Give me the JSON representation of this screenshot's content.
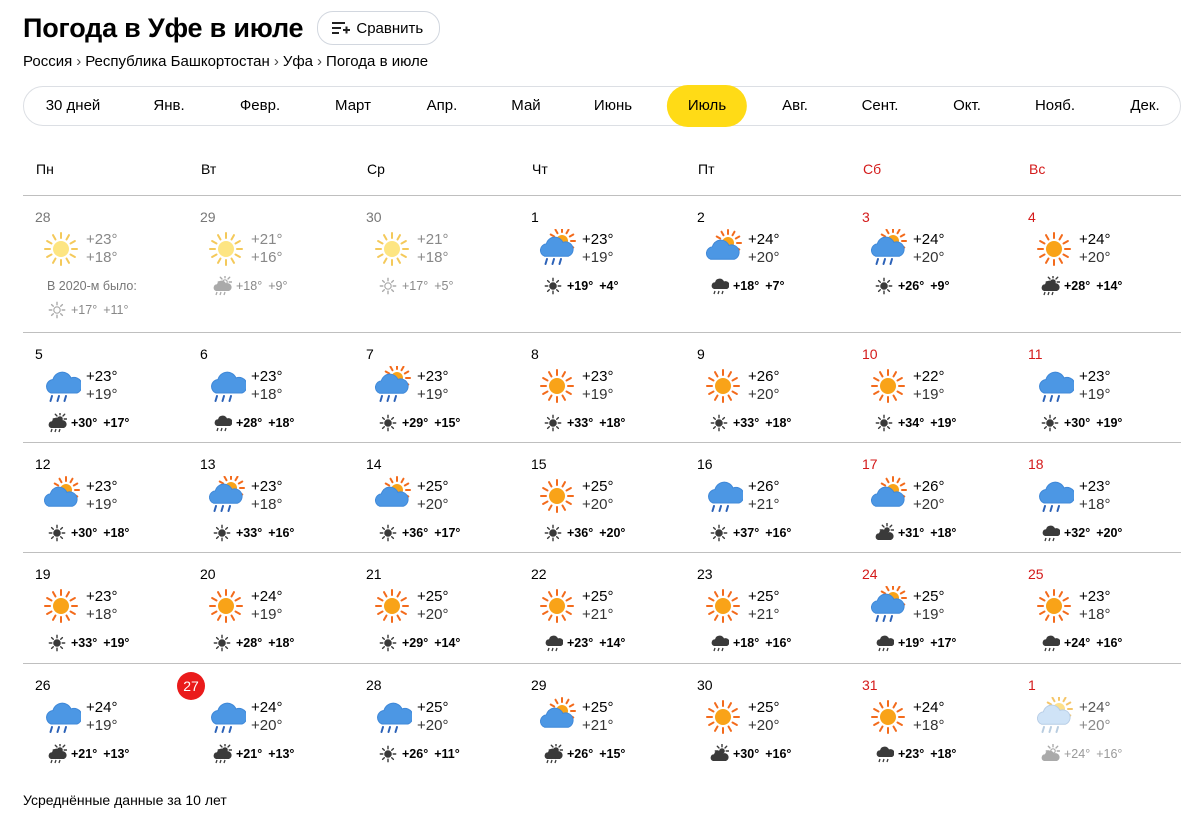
{
  "page": {
    "title": "Погода в Уфе в июле",
    "compare_label": "Сравнить",
    "breadcrumb": [
      "Россия",
      "Республика Башкортостан",
      "Уфа",
      "Погода в июле"
    ],
    "breadcrumb_separator": "›",
    "footer_note": "Усреднённые данные за 10 лет",
    "note_2020": "В 2020-м было:"
  },
  "month_tabs": [
    {
      "label": "30 дней",
      "active": false
    },
    {
      "label": "Янв.",
      "active": false
    },
    {
      "label": "Февр.",
      "active": false
    },
    {
      "label": "Март",
      "active": false
    },
    {
      "label": "Апр.",
      "active": false
    },
    {
      "label": "Май",
      "active": false
    },
    {
      "label": "Июнь",
      "active": false
    },
    {
      "label": "Июль",
      "active": true
    },
    {
      "label": "Авг.",
      "active": false
    },
    {
      "label": "Сент.",
      "active": false
    },
    {
      "label": "Окт.",
      "active": false
    },
    {
      "label": "Нояб.",
      "active": false
    },
    {
      "label": "Дек.",
      "active": false
    }
  ],
  "weekdays": [
    {
      "label": "Пн",
      "weekend": false
    },
    {
      "label": "Вт",
      "weekend": false
    },
    {
      "label": "Ср",
      "weekend": false
    },
    {
      "label": "Чт",
      "weekend": false
    },
    {
      "label": "Пт",
      "weekend": false
    },
    {
      "label": "Сб",
      "weekend": true
    },
    {
      "label": "Вс",
      "weekend": true
    }
  ],
  "colors": {
    "accent": "#ffdb16",
    "weekend": "#d41a1a",
    "today": "#ea1b1b"
  },
  "weeks": [
    [
      {
        "day": "28",
        "icon": "sun",
        "day_temp": "+23°",
        "night_temp": "+18°",
        "hist_icon": "sun",
        "hist_high": "",
        "hist_low": "",
        "other_month": true,
        "note": true,
        "note_icon": "sun-small",
        "note_high": "+17°",
        "note_low": "+11°"
      },
      {
        "day": "29",
        "icon": "sun",
        "day_temp": "+21°",
        "night_temp": "+16°",
        "hist_icon": "sun-cloud-rain",
        "hist_high": "+18°",
        "hist_low": "+9°",
        "other_month": true
      },
      {
        "day": "30",
        "icon": "sun",
        "day_temp": "+21°",
        "night_temp": "+18°",
        "hist_icon": "sun-small",
        "hist_high": "+17°",
        "hist_low": "+5°",
        "other_month": true
      },
      {
        "day": "1",
        "icon": "partly-rain",
        "day_temp": "+23°",
        "night_temp": "+19°",
        "hist_icon": "sun-small",
        "hist_high": "+19°",
        "hist_low": "+4°"
      },
      {
        "day": "2",
        "icon": "partly-cloudy",
        "day_temp": "+24°",
        "night_temp": "+20°",
        "hist_icon": "cloud-rain",
        "hist_high": "+18°",
        "hist_low": "+7°"
      },
      {
        "day": "3",
        "icon": "partly-rain",
        "day_temp": "+24°",
        "night_temp": "+20°",
        "hist_icon": "sun-small",
        "hist_high": "+26°",
        "hist_low": "+9°",
        "weekend": true
      },
      {
        "day": "4",
        "icon": "sun",
        "day_temp": "+24°",
        "night_temp": "+20°",
        "hist_icon": "sun-cloud-rain",
        "hist_high": "+28°",
        "hist_low": "+14°",
        "weekend": true
      }
    ],
    [
      {
        "day": "5",
        "icon": "cloud-rain",
        "day_temp": "+23°",
        "night_temp": "+19°",
        "hist_icon": "sun-cloud-rain",
        "hist_high": "+30°",
        "hist_low": "+17°"
      },
      {
        "day": "6",
        "icon": "cloud-rain",
        "day_temp": "+23°",
        "night_temp": "+18°",
        "hist_icon": "cloud-rain",
        "hist_high": "+28°",
        "hist_low": "+18°"
      },
      {
        "day": "7",
        "icon": "partly-rain",
        "day_temp": "+23°",
        "night_temp": "+19°",
        "hist_icon": "sun-small",
        "hist_high": "+29°",
        "hist_low": "+15°"
      },
      {
        "day": "8",
        "icon": "sun",
        "day_temp": "+23°",
        "night_temp": "+19°",
        "hist_icon": "sun-small",
        "hist_high": "+33°",
        "hist_low": "+18°"
      },
      {
        "day": "9",
        "icon": "sun",
        "day_temp": "+26°",
        "night_temp": "+20°",
        "hist_icon": "sun-small",
        "hist_high": "+33°",
        "hist_low": "+18°"
      },
      {
        "day": "10",
        "icon": "sun",
        "day_temp": "+22°",
        "night_temp": "+19°",
        "hist_icon": "sun-small",
        "hist_high": "+34°",
        "hist_low": "+19°",
        "weekend": true
      },
      {
        "day": "11",
        "icon": "cloud-rain",
        "day_temp": "+23°",
        "night_temp": "+19°",
        "hist_icon": "sun-small",
        "hist_high": "+30°",
        "hist_low": "+19°",
        "weekend": true
      }
    ],
    [
      {
        "day": "12",
        "icon": "partly-cloudy",
        "day_temp": "+23°",
        "night_temp": "+19°",
        "hist_icon": "sun-small",
        "hist_high": "+30°",
        "hist_low": "+18°"
      },
      {
        "day": "13",
        "icon": "partly-rain",
        "day_temp": "+23°",
        "night_temp": "+18°",
        "hist_icon": "sun-small",
        "hist_high": "+33°",
        "hist_low": "+16°"
      },
      {
        "day": "14",
        "icon": "partly-cloudy",
        "day_temp": "+25°",
        "night_temp": "+20°",
        "hist_icon": "sun-small",
        "hist_high": "+36°",
        "hist_low": "+17°"
      },
      {
        "day": "15",
        "icon": "sun",
        "day_temp": "+25°",
        "night_temp": "+20°",
        "hist_icon": "sun-small",
        "hist_high": "+36°",
        "hist_low": "+20°"
      },
      {
        "day": "16",
        "icon": "cloud-rain",
        "day_temp": "+26°",
        "night_temp": "+21°",
        "hist_icon": "sun-small",
        "hist_high": "+37°",
        "hist_low": "+16°"
      },
      {
        "day": "17",
        "icon": "partly-cloudy",
        "day_temp": "+26°",
        "night_temp": "+20°",
        "hist_icon": "cloud-sun",
        "hist_high": "+31°",
        "hist_low": "+18°",
        "weekend": true
      },
      {
        "day": "18",
        "icon": "cloud-rain",
        "day_temp": "+23°",
        "night_temp": "+18°",
        "hist_icon": "cloud-rain",
        "hist_high": "+32°",
        "hist_low": "+20°",
        "weekend": true
      }
    ],
    [
      {
        "day": "19",
        "icon": "sun",
        "day_temp": "+23°",
        "night_temp": "+18°",
        "hist_icon": "sun-small",
        "hist_high": "+33°",
        "hist_low": "+19°"
      },
      {
        "day": "20",
        "icon": "sun",
        "day_temp": "+24°",
        "night_temp": "+19°",
        "hist_icon": "sun-small",
        "hist_high": "+28°",
        "hist_low": "+18°"
      },
      {
        "day": "21",
        "icon": "sun",
        "day_temp": "+25°",
        "night_temp": "+20°",
        "hist_icon": "sun-small",
        "hist_high": "+29°",
        "hist_low": "+14°"
      },
      {
        "day": "22",
        "icon": "sun",
        "day_temp": "+25°",
        "night_temp": "+21°",
        "hist_icon": "cloud-rain",
        "hist_high": "+23°",
        "hist_low": "+14°"
      },
      {
        "day": "23",
        "icon": "sun",
        "day_temp": "+25°",
        "night_temp": "+21°",
        "hist_icon": "cloud-rain",
        "hist_high": "+18°",
        "hist_low": "+16°"
      },
      {
        "day": "24",
        "icon": "partly-rain",
        "day_temp": "+25°",
        "night_temp": "+19°",
        "hist_icon": "cloud-rain",
        "hist_high": "+19°",
        "hist_low": "+17°",
        "weekend": true
      },
      {
        "day": "25",
        "icon": "sun",
        "day_temp": "+23°",
        "night_temp": "+18°",
        "hist_icon": "cloud-rain",
        "hist_high": "+24°",
        "hist_low": "+16°",
        "weekend": true
      }
    ],
    [
      {
        "day": "26",
        "icon": "cloud-rain",
        "day_temp": "+24°",
        "night_temp": "+19°",
        "hist_icon": "sun-cloud-rain",
        "hist_high": "+21°",
        "hist_low": "+13°"
      },
      {
        "day": "27",
        "icon": "cloud-rain",
        "day_temp": "+24°",
        "night_temp": "+20°",
        "hist_icon": "sun-cloud-rain",
        "hist_high": "+21°",
        "hist_low": "+13°",
        "today": true
      },
      {
        "day": "28",
        "icon": "cloud-rain",
        "day_temp": "+25°",
        "night_temp": "+20°",
        "hist_icon": "sun-small",
        "hist_high": "+26°",
        "hist_low": "+11°"
      },
      {
        "day": "29",
        "icon": "partly-cloudy",
        "day_temp": "+25°",
        "night_temp": "+21°",
        "hist_icon": "sun-cloud-rain",
        "hist_high": "+26°",
        "hist_low": "+15°"
      },
      {
        "day": "30",
        "icon": "sun",
        "day_temp": "+25°",
        "night_temp": "+20°",
        "hist_icon": "cloud-sun",
        "hist_high": "+30°",
        "hist_low": "+16°"
      },
      {
        "day": "31",
        "icon": "sun",
        "day_temp": "+24°",
        "night_temp": "+18°",
        "hist_icon": "cloud-rain",
        "hist_high": "+23°",
        "hist_low": "+18°",
        "weekend": true
      },
      {
        "day": "1",
        "icon": "partly-rain",
        "day_temp": "+24°",
        "night_temp": "+20°",
        "hist_icon": "cloud-sun",
        "hist_high": "+24°",
        "hist_low": "+16°",
        "weekend": true,
        "other_month": true,
        "faded": true
      }
    ]
  ]
}
